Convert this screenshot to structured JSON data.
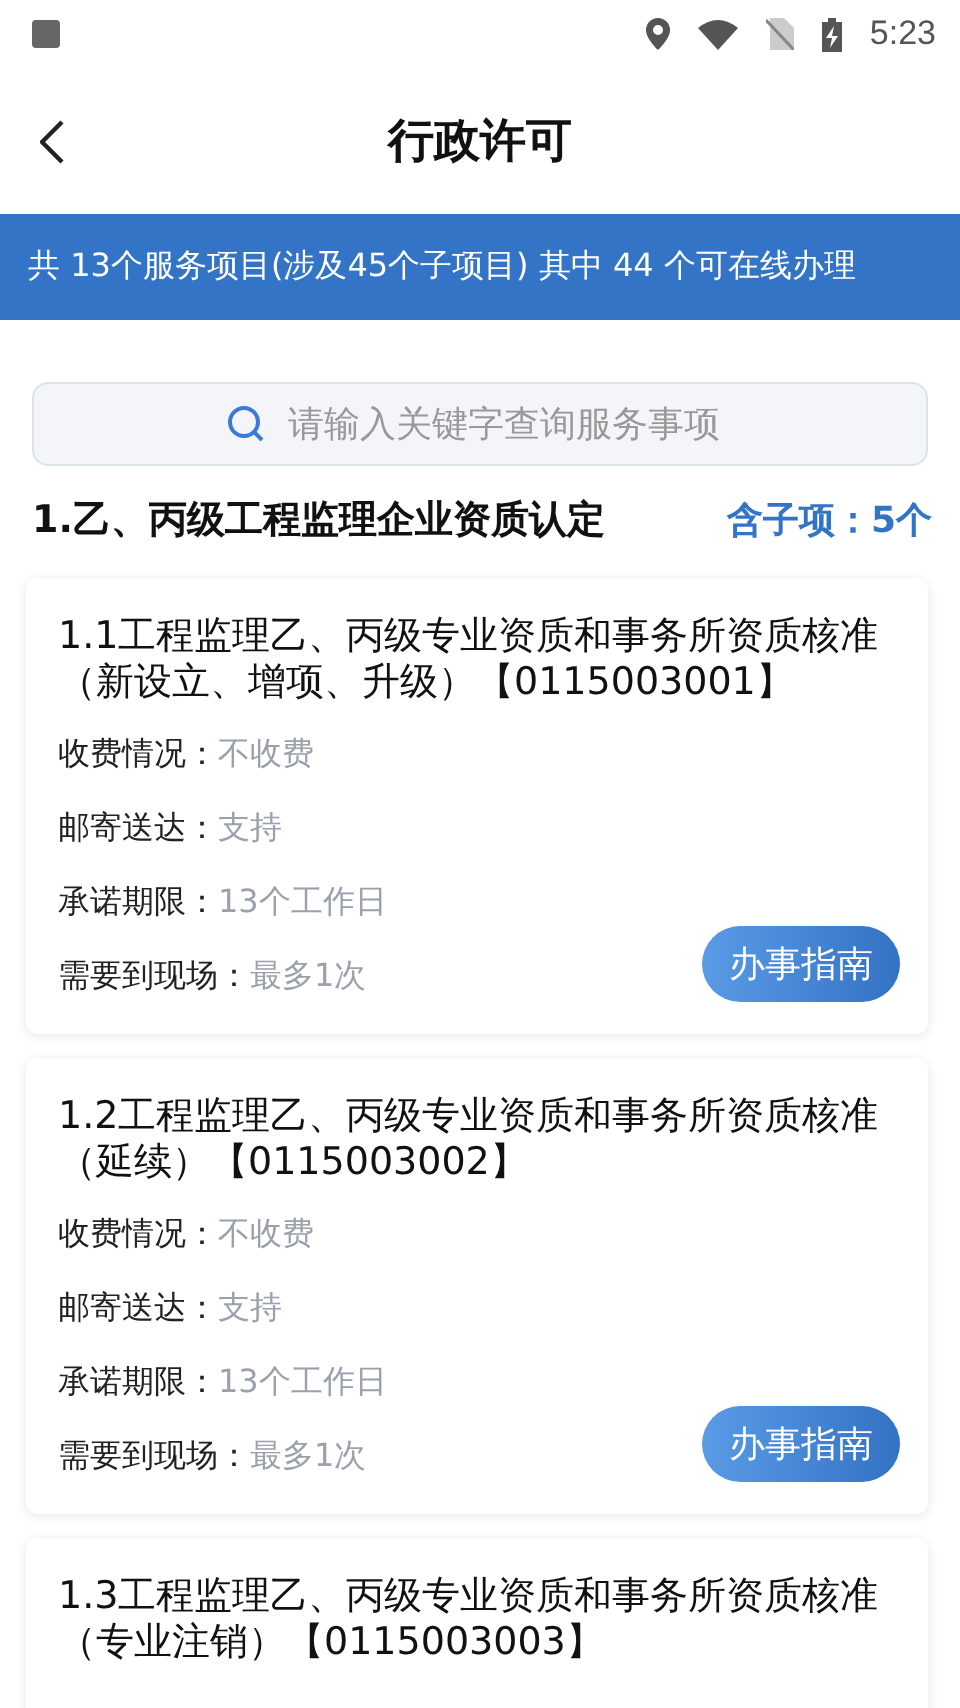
{
  "status_bar": {
    "time": "5:23"
  },
  "header": {
    "title": "行政许可"
  },
  "banner": {
    "text": "共 13个服务项目(涉及45个子项目) 其中 44 个可在线办理"
  },
  "search": {
    "placeholder": "请输入关键字查询服务事项"
  },
  "section": {
    "title": "1.乙、丙级工程监理企业资质认定",
    "count": "含子项：5个"
  },
  "items": [
    {
      "title": "1.1工程监理乙、丙级专业资质和事务所资质核准（新设立、增项、升级）【0115003001】",
      "fields": [
        {
          "label": "收费情况：",
          "value": "不收费"
        },
        {
          "label": "邮寄送达：",
          "value": "支持"
        },
        {
          "label": "承诺期限：",
          "value": "13个工作日"
        },
        {
          "label": "需要到现场：",
          "value": "最多1次"
        }
      ],
      "button": "办事指南"
    },
    {
      "title": "1.2工程监理乙、丙级专业资质和事务所资质核准（延续）【0115003002】",
      "fields": [
        {
          "label": "收费情况：",
          "value": "不收费"
        },
        {
          "label": "邮寄送达：",
          "value": "支持"
        },
        {
          "label": "承诺期限：",
          "value": "13个工作日"
        },
        {
          "label": "需要到现场：",
          "value": "最多1次"
        }
      ],
      "button": "办事指南"
    },
    {
      "title": "1.3工程监理乙、丙级专业资质和事务所资质核准（专业注销）【0115003003】"
    }
  ]
}
